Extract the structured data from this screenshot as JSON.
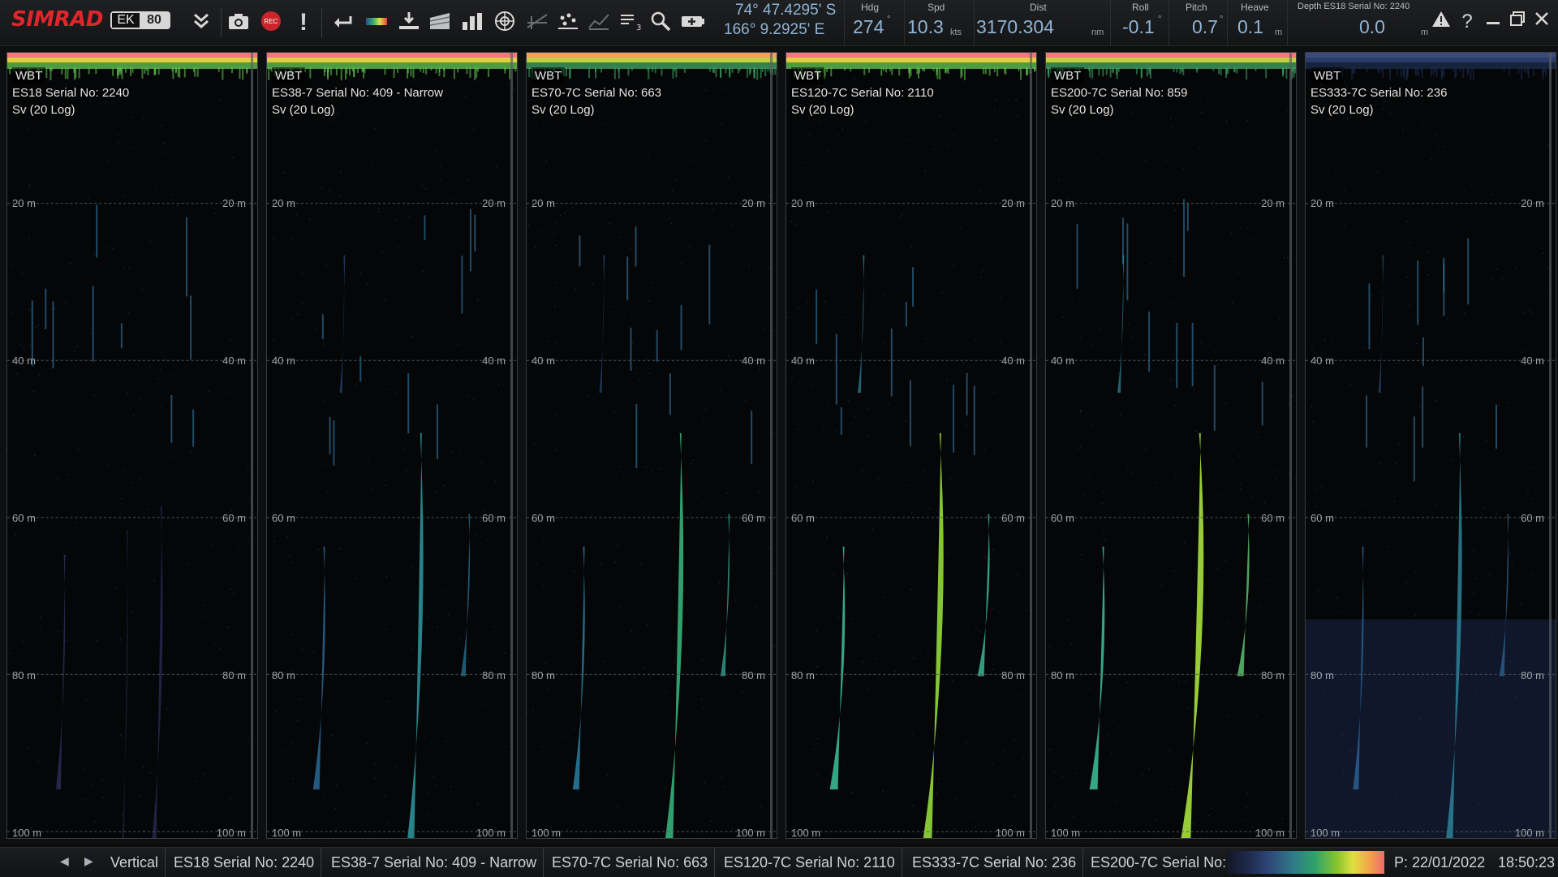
{
  "app": {
    "brand": "SIMRAD",
    "model_left": "EK",
    "model_right": "80"
  },
  "toolbar": {
    "icons": [
      "chevron-double-down-icon",
      "camera-icon",
      "record-icon",
      "alarm-exclamation-icon",
      "back-arrow-icon",
      "color-bar-icon",
      "bottom-detection-icon",
      "echogram-icon",
      "bar-chart-icon",
      "target-icon",
      "grid-disabled-icon",
      "scatter-icon",
      "graph-disabled-icon",
      "numeric-display-icon",
      "zoom-icon",
      "battery-icon"
    ],
    "record_label": "REC"
  },
  "position": {
    "lat": "74° 47.4295' S",
    "lon": "166° 9.2925' E"
  },
  "readouts": {
    "hdg": {
      "label": "Hdg",
      "value": "274",
      "unit": "°"
    },
    "spd": {
      "label": "Spd",
      "value": "10.3",
      "unit": "kts"
    },
    "dist": {
      "label": "Dist",
      "value": "3170.304",
      "unit": "nm"
    },
    "roll": {
      "label": "Roll",
      "value": "-0.1",
      "unit": "°"
    },
    "pitch": {
      "label": "Pitch",
      "value": "0.7",
      "unit": "°"
    },
    "heave": {
      "label": "Heave",
      "value": "0.1",
      "unit": "m"
    },
    "depth": {
      "label": "Depth ES18 Serial No: 2240",
      "value": "0.0",
      "unit": "m"
    }
  },
  "panels": [
    {
      "mode": "WBT",
      "name": "ES18 Serial No: 2240",
      "mode2": "Sv (20 Log)"
    },
    {
      "mode": "WBT",
      "name": "ES38-7 Serial No: 409 - Narrow",
      "mode2": "Sv (20 Log)"
    },
    {
      "mode": "WBT",
      "name": "ES70-7C Serial No: 663",
      "mode2": "Sv (20 Log)"
    },
    {
      "mode": "WBT",
      "name": "ES120-7C Serial No: 2110",
      "mode2": "Sv (20 Log)"
    },
    {
      "mode": "WBT",
      "name": "ES200-7C Serial No: 859",
      "mode2": "Sv (20 Log)"
    },
    {
      "mode": "WBT",
      "name": "ES333-7C Serial No: 236",
      "mode2": "Sv (20 Log)"
    }
  ],
  "depth_labels": [
    "20 m",
    "40 m",
    "60 m",
    "80 m",
    "100 m"
  ],
  "bottom": {
    "view": "Vertical",
    "tabs": [
      "ES18 Serial No: 2240",
      "ES38-7 Serial No: 409 - Narrow",
      "ES70-7C Serial No: 663",
      "ES120-7C Serial No: 2110",
      "ES333-7C Serial No: 236",
      "ES200-7C Serial No:"
    ],
    "playback": "P: 22/01/2022",
    "time": "18:50:23"
  }
}
